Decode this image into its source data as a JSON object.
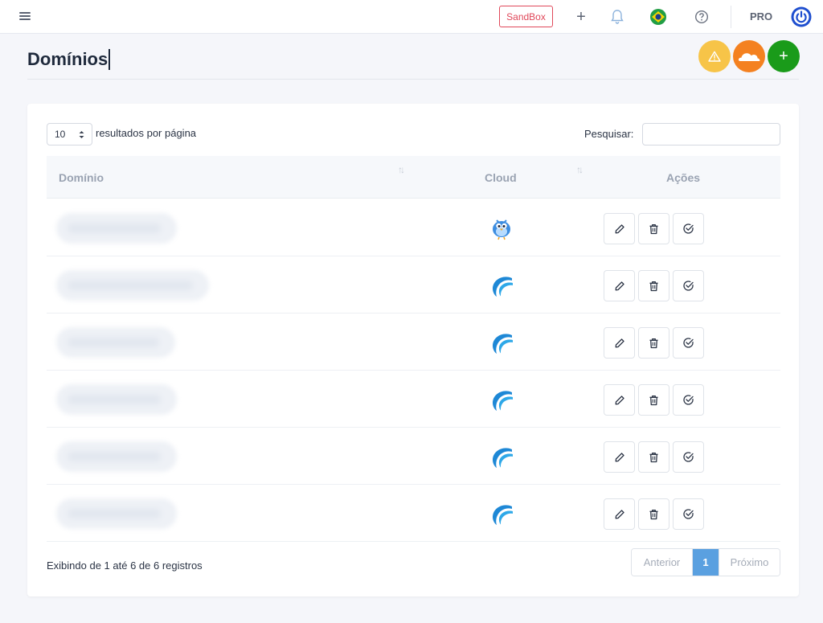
{
  "header": {
    "sandbox_label": "SandBox",
    "plus_label": "+",
    "pro_label": "PRO",
    "icons": [
      "menu-icon",
      "plus-icon",
      "bell-icon",
      "brazil-flag-icon",
      "help-icon",
      "power-icon"
    ]
  },
  "page": {
    "title": "Domínios",
    "fab_add_label": "+",
    "fab_icons": [
      "warning-icon",
      "cloudflare-icon",
      "plus-icon"
    ]
  },
  "table": {
    "length_value": "10",
    "length_label": "resultados por página",
    "search_label": "Pesquisar:",
    "search_value": "",
    "columns": [
      "Domínio",
      "Cloud",
      "Ações"
    ],
    "rows": [
      {
        "cloud_icon": "bird-cloud-icon"
      },
      {
        "cloud_icon": "wave-cloud-icon"
      },
      {
        "cloud_icon": "wave-cloud-icon"
      },
      {
        "cloud_icon": "wave-cloud-icon"
      },
      {
        "cloud_icon": "wave-cloud-icon"
      },
      {
        "cloud_icon": "wave-cloud-icon"
      }
    ],
    "info": "Exibindo de 1 até 6 de 6 registros",
    "pagination": {
      "prev": "Anterior",
      "current": "1",
      "next": "Próximo"
    }
  },
  "colors": {
    "accent": "#5aa0e0",
    "sandbox": "#e0485a",
    "warning": "#f7c448",
    "cloudflare": "#f48120",
    "add": "#1a9b1a"
  }
}
